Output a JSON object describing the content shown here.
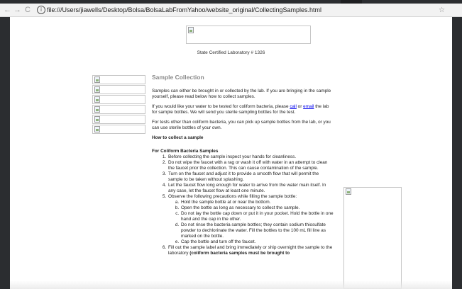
{
  "browser": {
    "back_glyph": "←",
    "forward_glyph": "→",
    "reload_glyph": "C",
    "info_glyph": "i",
    "url": "file:///Users/jiawells/Desktop/Bolsa/BolsaLabFromYahoo/website_original/CollectingSamples.html",
    "bookmark_glyph": "☆"
  },
  "page": {
    "lab_line": "State Certified Laboratory # 1326",
    "heading": "Sample Collection",
    "intro": "Samples can either be brought in or collected by the lab.  If you are bringing in the sample yourself, please read below how to collect samples.",
    "coliform_pre": "If you would like your water to be tested for coliform bacteria, please ",
    "call_link": "call",
    "or_text": " or ",
    "email_link": "email",
    "coliform_post": " the lab for sample bottles.  We will send you sterile sampling bottles for the test.",
    "other_tests": "For tests other than coliform bacteria, you can pick up sample bottles from the lab, or you can use sterile bottles of your own.",
    "how_to": "How to collect a sample",
    "coliform_heading": "For Coliform Bacteria Samples",
    "steps": [
      "Before collecting the sample inspect your hands for cleanliness.",
      "Do not wipe the faucet with a rag or wash it off with water in an attempt to clean the faucet prior the collection.  This can cause contamination of the sample.",
      "Turn on the faucet and adjust it to provide a smooth flow that will permit the sample to be taken without splashing.",
      "Let the faucet flow long enough for water to arrive from the water main itself. In any case, let the faucet flow at least one minute.",
      "Observe the following precautions while filling the sample bottle:"
    ],
    "substeps": [
      "Hold the sample bottle at or near the bottom.",
      "Open the bottle as long as necessary to collect the sample.",
      "Do not lay the bottle cap down or put it in your pocket. Hold the bottle in one hand and the cap in the other.",
      "Do not rinse the bacteria sample bottles; they contain sodium thiosulfate powder to dechlorinate the water.  Fill the bottles to the 100 mL fill line as marked on the bottle.",
      "Cap the bottle and turn off the faucet."
    ],
    "step6_pre": "Fill out the sample label and bring immediately or ship overnight the sample to the laboratory ",
    "step6_bold": "(coliform bacteria samples must be brought to"
  },
  "colors": {
    "chrome_bg": "#f2f2f2",
    "dark_frame": "#2b2d30",
    "link": "#0000ee",
    "heading_gray": "#8a8a8a"
  }
}
